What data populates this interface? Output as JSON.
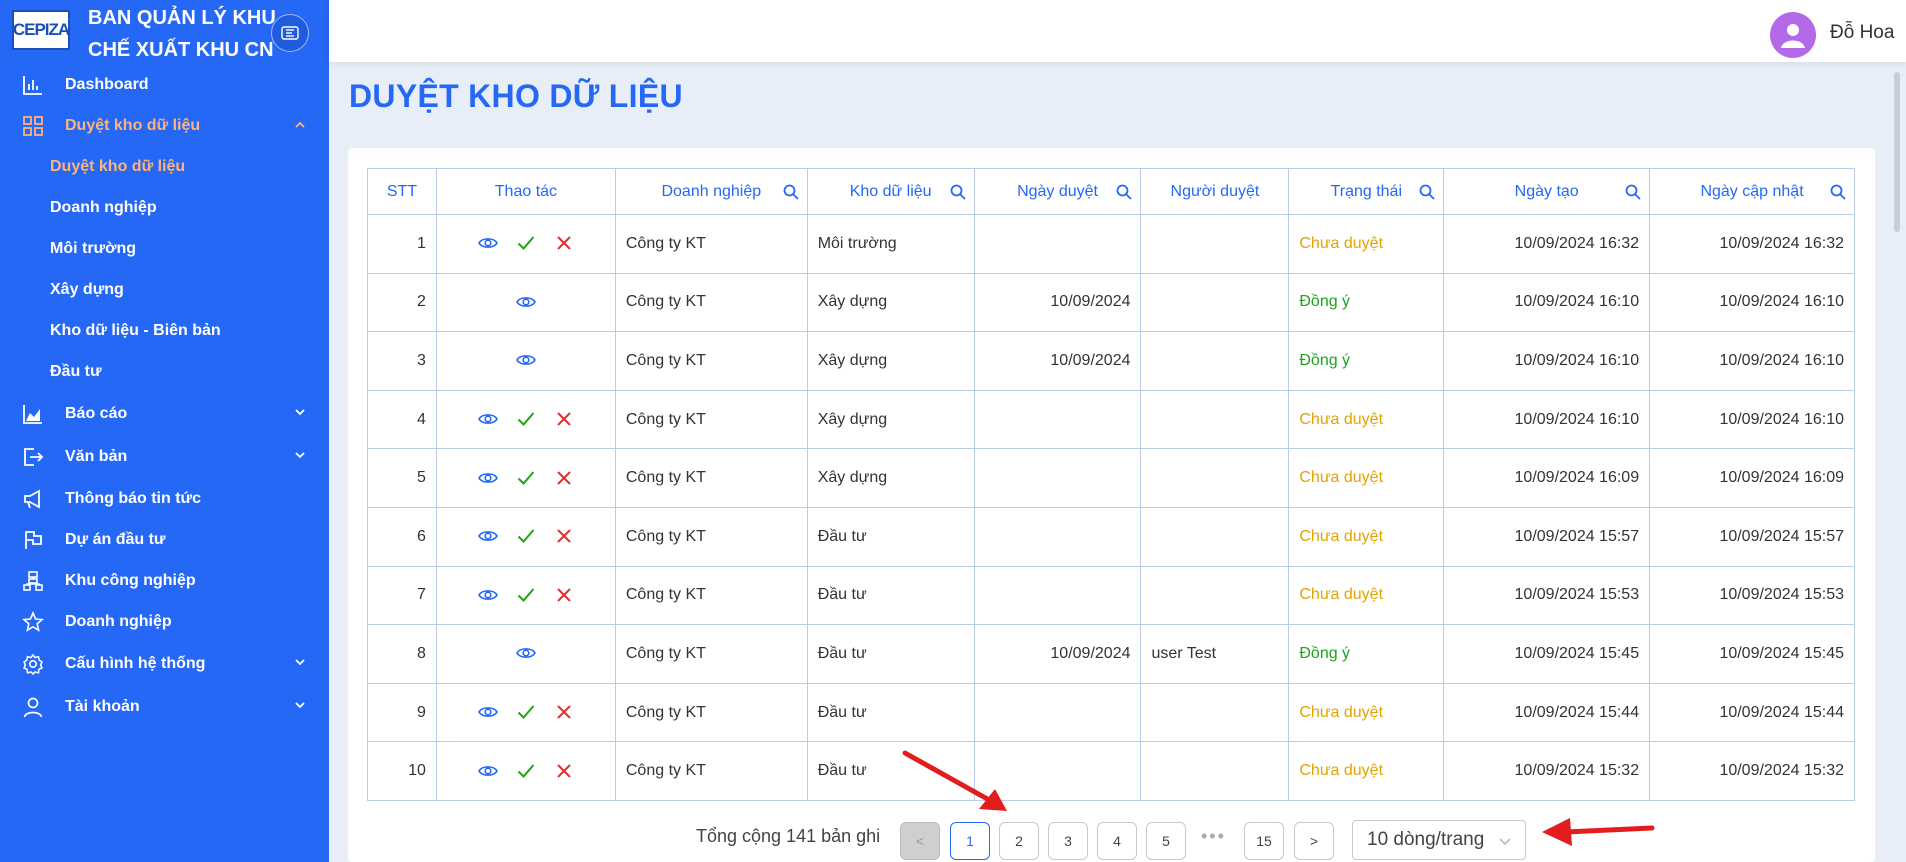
{
  "brand": {
    "logo_text": "CEPIZA",
    "title_line1": "BAN QUẢN LÝ KHU",
    "title_line2": "CHẾ XUẤT KHU CN"
  },
  "sidebar": {
    "items": [
      {
        "label": "Dashboard",
        "icon": "bar-chart-icon"
      },
      {
        "label": "Duyệt kho dữ liệu",
        "icon": "grid-icon",
        "active": true,
        "expanded": true,
        "children": [
          "Duyệt kho dữ liệu",
          "Doanh nghiệp",
          "Môi trường",
          "Xây dựng",
          "Kho dữ liệu - Biên bản",
          "Đầu tư"
        ]
      },
      {
        "label": "Báo cáo",
        "icon": "area-chart-icon"
      },
      {
        "label": "Văn bản",
        "icon": "export-icon"
      },
      {
        "label": "Thông báo tin tức",
        "icon": "megaphone-icon"
      },
      {
        "label": "Dự án đầu tư",
        "icon": "flag-icon"
      },
      {
        "label": "Khu công nghiệp",
        "icon": "cluster-icon"
      },
      {
        "label": "Doanh nghiệp",
        "icon": "star-icon"
      },
      {
        "label": "Cấu hình hệ thống",
        "icon": "gear-icon"
      },
      {
        "label": "Tài khoản",
        "icon": "user-icon"
      }
    ]
  },
  "header": {
    "username": "Đỗ Hoa"
  },
  "page": {
    "title": "DUYỆT KHO DỮ LIỆU"
  },
  "table": {
    "columns": [
      "STT",
      "Thao tác",
      "Doanh nghiệp",
      "Kho dữ liệu",
      "Ngày duyệt",
      "Người duyệt",
      "Trạng thái",
      "Ngày tạo",
      "Ngày cập nhật"
    ],
    "rows": [
      {
        "stt": "1",
        "actions": "full",
        "company": "Công ty KT",
        "store": "Môi trường",
        "approved_date": "",
        "approver": "",
        "status": "Chưa duyệt",
        "status_type": "pending",
        "created": "10/09/2024 16:32",
        "updated": "10/09/2024 16:32"
      },
      {
        "stt": "2",
        "actions": "view",
        "company": "Công ty KT",
        "store": "Xây dựng",
        "approved_date": "10/09/2024",
        "approver": "",
        "status": "Đồng ý",
        "status_type": "ok",
        "created": "10/09/2024 16:10",
        "updated": "10/09/2024 16:10"
      },
      {
        "stt": "3",
        "actions": "view",
        "company": "Công ty KT",
        "store": "Xây dựng",
        "approved_date": "10/09/2024",
        "approver": "",
        "status": "Đồng ý",
        "status_type": "ok",
        "created": "10/09/2024 16:10",
        "updated": "10/09/2024 16:10"
      },
      {
        "stt": "4",
        "actions": "full",
        "company": "Công ty KT",
        "store": "Xây dựng",
        "approved_date": "",
        "approver": "",
        "status": "Chưa duyệt",
        "status_type": "pending",
        "created": "10/09/2024 16:10",
        "updated": "10/09/2024 16:10"
      },
      {
        "stt": "5",
        "actions": "full",
        "company": "Công ty KT",
        "store": "Xây dựng",
        "approved_date": "",
        "approver": "",
        "status": "Chưa duyệt",
        "status_type": "pending",
        "created": "10/09/2024 16:09",
        "updated": "10/09/2024 16:09"
      },
      {
        "stt": "6",
        "actions": "full",
        "company": "Công ty KT",
        "store": "Đầu tư",
        "approved_date": "",
        "approver": "",
        "status": "Chưa duyệt",
        "status_type": "pending",
        "created": "10/09/2024 15:57",
        "updated": "10/09/2024 15:57"
      },
      {
        "stt": "7",
        "actions": "full",
        "company": "Công ty KT",
        "store": "Đầu tư",
        "approved_date": "",
        "approver": "",
        "status": "Chưa duyệt",
        "status_type": "pending",
        "created": "10/09/2024 15:53",
        "updated": "10/09/2024 15:53"
      },
      {
        "stt": "8",
        "actions": "view",
        "company": "Công ty KT",
        "store": "Đầu tư",
        "approved_date": "10/09/2024",
        "approver": "user Test",
        "status": "Đồng ý",
        "status_type": "ok",
        "created": "10/09/2024 15:45",
        "updated": "10/09/2024 15:45"
      },
      {
        "stt": "9",
        "actions": "full",
        "company": "Công ty KT",
        "store": "Đầu tư",
        "approved_date": "",
        "approver": "",
        "status": "Chưa duyệt",
        "status_type": "pending",
        "created": "10/09/2024 15:44",
        "updated": "10/09/2024 15:44"
      },
      {
        "stt": "10",
        "actions": "full",
        "company": "Công ty KT",
        "store": "Đầu tư",
        "approved_date": "",
        "approver": "",
        "status": "Chưa duyệt",
        "status_type": "pending",
        "created": "10/09/2024 15:32",
        "updated": "10/09/2024 15:32"
      }
    ]
  },
  "pagination": {
    "total_text": "Tổng cộng 141 bản ghi",
    "prev": "<",
    "pages": [
      "1",
      "2",
      "3",
      "4",
      "5"
    ],
    "ellipsis": "•••",
    "last_page": "15",
    "next": ">",
    "current": "1",
    "page_size": "10 dòng/trang"
  },
  "colors": {
    "primary": "#2468f5",
    "active_menu": "#ffb27a",
    "pending": "#e3a300",
    "approved": "#1aa51a",
    "annotation_arrow": "#e11d1d"
  }
}
